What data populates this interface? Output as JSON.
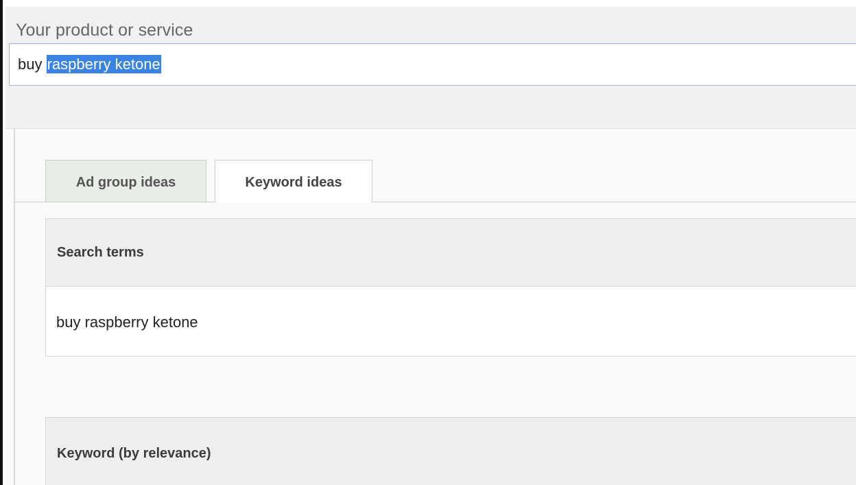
{
  "product_field": {
    "label": "Your product or service",
    "value_unselected": "buy ",
    "value_selected": "raspberry ketone"
  },
  "tabs": [
    {
      "label": "Ad group ideas",
      "active": false
    },
    {
      "label": "Keyword ideas",
      "active": true
    }
  ],
  "search_terms": {
    "header": "Search terms",
    "rows": [
      "buy raspberry ketone"
    ]
  },
  "keyword_table": {
    "header": "Keyword (by relevance)"
  },
  "colors": {
    "selection": "#3a83e6",
    "input_border": "#9ab7e6",
    "header_bg": "#eeeeee",
    "inactive_tab_bg": "#e8ede7"
  }
}
